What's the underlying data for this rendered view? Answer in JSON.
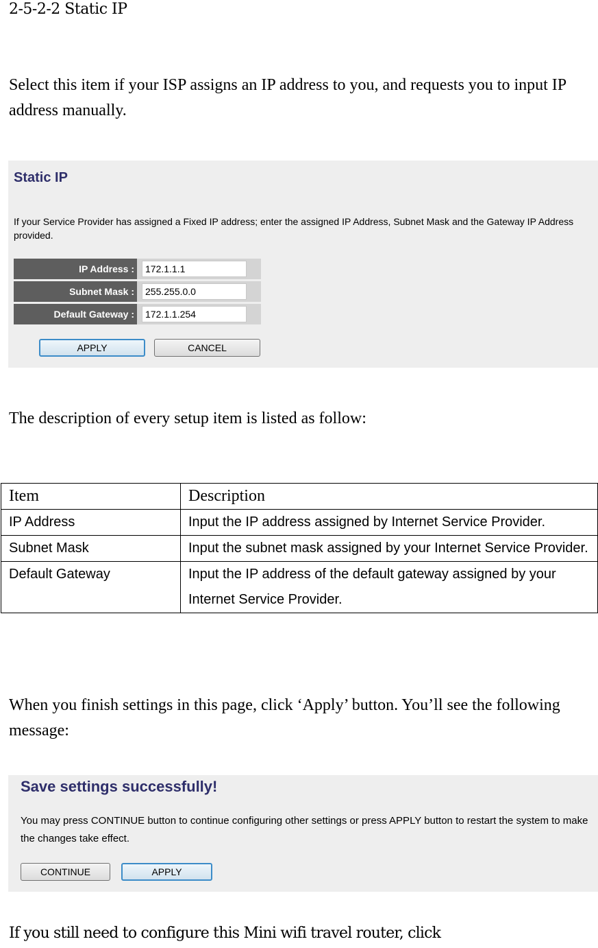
{
  "document": {
    "section_heading": "2-5-2-2 Static IP",
    "intro_paragraph": "Select this item if your ISP assigns an IP address to you, and requests you to input IP address manually.",
    "description_intro": "The description of every setup item is listed as follow:",
    "after_table_paragraph": "When you finish settings in this page, click ‘Apply’ button. You’ll see the following message:",
    "closing_fragment": "If you still need to configure this Mini wifi travel router, click"
  },
  "static_ip_screenshot": {
    "title": "Static IP",
    "description": "If your Service Provider has assigned a Fixed IP address; enter the assigned IP Address, Subnet Mask and the Gateway IP Address provided.",
    "fields": [
      {
        "label": "IP Address :",
        "value": "172.1.1.1"
      },
      {
        "label": "Subnet Mask :",
        "value": "255.255.0.0"
      },
      {
        "label": "Default Gateway :",
        "value": "172.1.1.254"
      }
    ],
    "apply_label": "APPLY",
    "cancel_label": "CANCEL",
    "colors": {
      "title": "#2e2e6a",
      "label_bg": "#5e5e5e",
      "panel_bg": "#eeeeee",
      "focus_border": "#3c8cc8"
    }
  },
  "description_table": {
    "headers": [
      "Item",
      "Description"
    ],
    "rows": [
      {
        "item": "IP Address",
        "description": "Input the IP address assigned by Internet Service Provider."
      },
      {
        "item": "Subnet Mask",
        "description": "Input the subnet mask assigned by your Internet Service Provider."
      },
      {
        "item": "Default Gateway",
        "description": "Input the IP address of the default gateway assigned by your Internet Service Provider."
      }
    ]
  },
  "save_screenshot": {
    "title": "Save settings successfully!",
    "message": "You may press CONTINUE button to continue configuring other settings or press APPLY button to restart the system to make the changes take effect.",
    "continue_label": "CONTINUE",
    "apply_label": "APPLY"
  }
}
